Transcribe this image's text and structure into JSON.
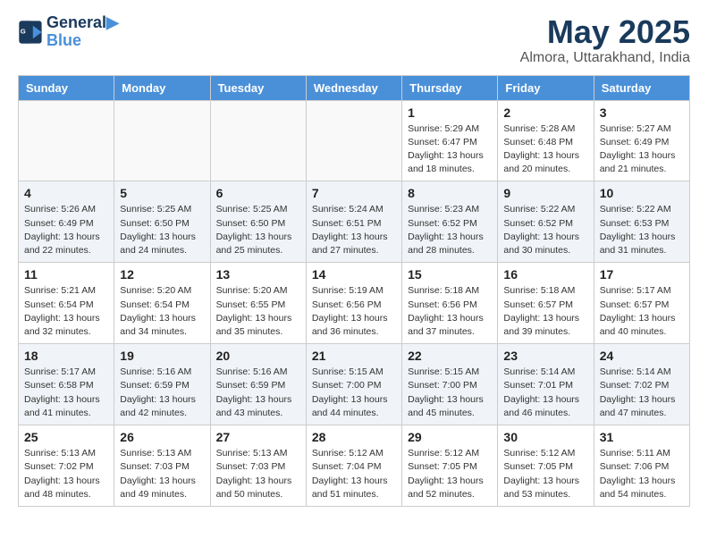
{
  "logo": {
    "line1": "General",
    "line2": "Blue"
  },
  "title": "May 2025",
  "location": "Almora, Uttarakhand, India",
  "days_of_week": [
    "Sunday",
    "Monday",
    "Tuesday",
    "Wednesday",
    "Thursday",
    "Friday",
    "Saturday"
  ],
  "weeks": [
    [
      {
        "num": "",
        "info": ""
      },
      {
        "num": "",
        "info": ""
      },
      {
        "num": "",
        "info": ""
      },
      {
        "num": "",
        "info": ""
      },
      {
        "num": "1",
        "info": "Sunrise: 5:29 AM\nSunset: 6:47 PM\nDaylight: 13 hours\nand 18 minutes."
      },
      {
        "num": "2",
        "info": "Sunrise: 5:28 AM\nSunset: 6:48 PM\nDaylight: 13 hours\nand 20 minutes."
      },
      {
        "num": "3",
        "info": "Sunrise: 5:27 AM\nSunset: 6:49 PM\nDaylight: 13 hours\nand 21 minutes."
      }
    ],
    [
      {
        "num": "4",
        "info": "Sunrise: 5:26 AM\nSunset: 6:49 PM\nDaylight: 13 hours\nand 22 minutes."
      },
      {
        "num": "5",
        "info": "Sunrise: 5:25 AM\nSunset: 6:50 PM\nDaylight: 13 hours\nand 24 minutes."
      },
      {
        "num": "6",
        "info": "Sunrise: 5:25 AM\nSunset: 6:50 PM\nDaylight: 13 hours\nand 25 minutes."
      },
      {
        "num": "7",
        "info": "Sunrise: 5:24 AM\nSunset: 6:51 PM\nDaylight: 13 hours\nand 27 minutes."
      },
      {
        "num": "8",
        "info": "Sunrise: 5:23 AM\nSunset: 6:52 PM\nDaylight: 13 hours\nand 28 minutes."
      },
      {
        "num": "9",
        "info": "Sunrise: 5:22 AM\nSunset: 6:52 PM\nDaylight: 13 hours\nand 30 minutes."
      },
      {
        "num": "10",
        "info": "Sunrise: 5:22 AM\nSunset: 6:53 PM\nDaylight: 13 hours\nand 31 minutes."
      }
    ],
    [
      {
        "num": "11",
        "info": "Sunrise: 5:21 AM\nSunset: 6:54 PM\nDaylight: 13 hours\nand 32 minutes."
      },
      {
        "num": "12",
        "info": "Sunrise: 5:20 AM\nSunset: 6:54 PM\nDaylight: 13 hours\nand 34 minutes."
      },
      {
        "num": "13",
        "info": "Sunrise: 5:20 AM\nSunset: 6:55 PM\nDaylight: 13 hours\nand 35 minutes."
      },
      {
        "num": "14",
        "info": "Sunrise: 5:19 AM\nSunset: 6:56 PM\nDaylight: 13 hours\nand 36 minutes."
      },
      {
        "num": "15",
        "info": "Sunrise: 5:18 AM\nSunset: 6:56 PM\nDaylight: 13 hours\nand 37 minutes."
      },
      {
        "num": "16",
        "info": "Sunrise: 5:18 AM\nSunset: 6:57 PM\nDaylight: 13 hours\nand 39 minutes."
      },
      {
        "num": "17",
        "info": "Sunrise: 5:17 AM\nSunset: 6:57 PM\nDaylight: 13 hours\nand 40 minutes."
      }
    ],
    [
      {
        "num": "18",
        "info": "Sunrise: 5:17 AM\nSunset: 6:58 PM\nDaylight: 13 hours\nand 41 minutes."
      },
      {
        "num": "19",
        "info": "Sunrise: 5:16 AM\nSunset: 6:59 PM\nDaylight: 13 hours\nand 42 minutes."
      },
      {
        "num": "20",
        "info": "Sunrise: 5:16 AM\nSunset: 6:59 PM\nDaylight: 13 hours\nand 43 minutes."
      },
      {
        "num": "21",
        "info": "Sunrise: 5:15 AM\nSunset: 7:00 PM\nDaylight: 13 hours\nand 44 minutes."
      },
      {
        "num": "22",
        "info": "Sunrise: 5:15 AM\nSunset: 7:00 PM\nDaylight: 13 hours\nand 45 minutes."
      },
      {
        "num": "23",
        "info": "Sunrise: 5:14 AM\nSunset: 7:01 PM\nDaylight: 13 hours\nand 46 minutes."
      },
      {
        "num": "24",
        "info": "Sunrise: 5:14 AM\nSunset: 7:02 PM\nDaylight: 13 hours\nand 47 minutes."
      }
    ],
    [
      {
        "num": "25",
        "info": "Sunrise: 5:13 AM\nSunset: 7:02 PM\nDaylight: 13 hours\nand 48 minutes."
      },
      {
        "num": "26",
        "info": "Sunrise: 5:13 AM\nSunset: 7:03 PM\nDaylight: 13 hours\nand 49 minutes."
      },
      {
        "num": "27",
        "info": "Sunrise: 5:13 AM\nSunset: 7:03 PM\nDaylight: 13 hours\nand 50 minutes."
      },
      {
        "num": "28",
        "info": "Sunrise: 5:12 AM\nSunset: 7:04 PM\nDaylight: 13 hours\nand 51 minutes."
      },
      {
        "num": "29",
        "info": "Sunrise: 5:12 AM\nSunset: 7:05 PM\nDaylight: 13 hours\nand 52 minutes."
      },
      {
        "num": "30",
        "info": "Sunrise: 5:12 AM\nSunset: 7:05 PM\nDaylight: 13 hours\nand 53 minutes."
      },
      {
        "num": "31",
        "info": "Sunrise: 5:11 AM\nSunset: 7:06 PM\nDaylight: 13 hours\nand 54 minutes."
      }
    ]
  ]
}
